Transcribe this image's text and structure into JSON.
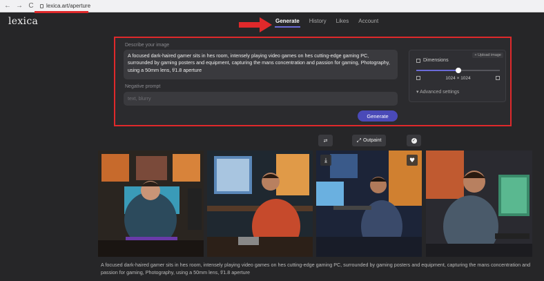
{
  "browser": {
    "url": "lexica.art/aperture",
    "back": "←",
    "forward": "→",
    "reload": "C"
  },
  "brand": {
    "logo": "lexica"
  },
  "nav": {
    "tabs": [
      {
        "label": "Generate",
        "active": true
      },
      {
        "label": "History"
      },
      {
        "label": "Likes"
      },
      {
        "label": "Account"
      }
    ]
  },
  "form": {
    "prompt_label": "Describe your image",
    "prompt_value": "A focused dark-haired gamer sits in hes room, intensely playing video games on hes cutting-edge gaming PC, surrounded by gaming posters and equipment, capturing the mans concentration and passion for gaming, Photography, using a 50mm lens, f/1.8 aperture",
    "negative_label": "Negative prompt",
    "negative_placeholder": "text, blurry",
    "generate_label": "Generate"
  },
  "settings": {
    "upload_label": "+ Upload image",
    "dimensions_label": "Dimensions",
    "dimensions_value": "1024 × 1024",
    "slider_fraction": 0.5,
    "advanced_label": "Advanced settings"
  },
  "actions": {
    "outpaint_label": "Outpaint"
  },
  "result": {
    "caption": "A focused dark-haired gamer sits in hes room, intensely playing video games on hes cutting-edge gaming PC, surrounded by gaming posters and equipment, capturing the mans concentration and passion for gaming, Photography, using a 50mm lens, f/1.8 aperture"
  },
  "colors": {
    "accent": "#4a4ab8",
    "highlight": "#e0292b",
    "background": "#262628"
  }
}
